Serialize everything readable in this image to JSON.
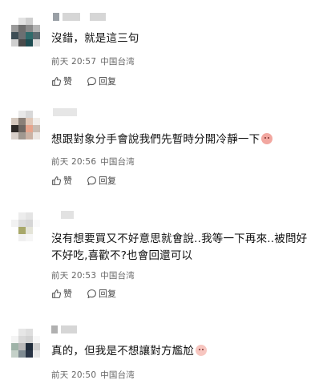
{
  "comments": [
    {
      "text": "沒錯，就是這三句",
      "time": "前天 20:57",
      "location": "中国台湾",
      "like_label": "赞",
      "reply_label": "回复"
    },
    {
      "text": "想跟對象分手會說我們先暫時分開冷靜一下",
      "time": "前天 20:56",
      "location": "中国台湾",
      "like_label": "赞",
      "reply_label": "回复"
    },
    {
      "text": "沒有想要買又不好意思就會說..我等一下再來..被問好不好吃,喜歡不?也會回還可以",
      "time": "前天 20:53",
      "location": "中国台湾",
      "like_label": "赞",
      "reply_label": "回复"
    },
    {
      "text": "真的，但我是不想讓對方尷尬",
      "time": "前天 20:50",
      "location": "中国台湾"
    }
  ],
  "icons": {
    "like": "thumbs-up-icon",
    "reply": "speech-bubble-icon",
    "emoji": "face-emoji-icon"
  }
}
